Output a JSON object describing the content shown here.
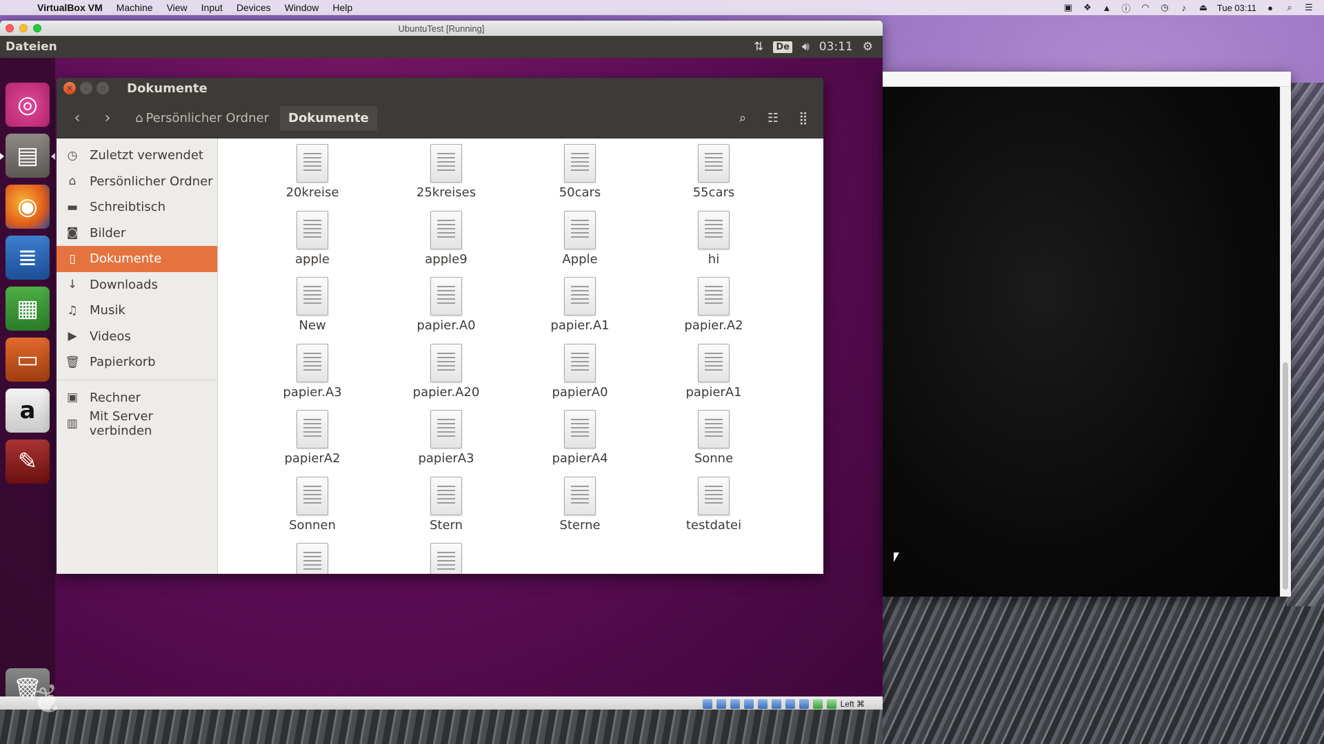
{
  "mac_menubar": {
    "app": "VirtualBox VM",
    "menus": [
      "Machine",
      "View",
      "Input",
      "Devices",
      "Window",
      "Help"
    ],
    "clock": "Tue 03:11"
  },
  "vbox": {
    "title": "UbuntuTest [Running]",
    "status_host_key": "Left ⌘"
  },
  "ubuntu_panel": {
    "app_name": "Dateien",
    "lang": "De",
    "time": "03:11"
  },
  "nautilus": {
    "title": "Dokumente",
    "breadcrumb": {
      "home": "Persönlicher Ordner",
      "current": "Dokumente"
    },
    "sidebar": {
      "items": [
        {
          "label": "Zuletzt verwendet",
          "icon": "clock-icon"
        },
        {
          "label": "Persönlicher Ordner",
          "icon": "home-icon"
        },
        {
          "label": "Schreibtisch",
          "icon": "desktop-folder-icon"
        },
        {
          "label": "Bilder",
          "icon": "camera-icon"
        },
        {
          "label": "Dokumente",
          "icon": "document-icon",
          "active": true
        },
        {
          "label": "Downloads",
          "icon": "download-icon"
        },
        {
          "label": "Musik",
          "icon": "music-icon"
        },
        {
          "label": "Videos",
          "icon": "video-icon"
        },
        {
          "label": "Papierkorb",
          "icon": "trash-icon"
        }
      ],
      "network": [
        {
          "label": "Rechner",
          "icon": "computer-icon"
        },
        {
          "label": "Mit Server verbinden",
          "icon": "server-icon"
        }
      ]
    },
    "files": [
      "20kreise",
      "25kreises",
      "50cars",
      "55cars",
      "apple",
      "apple9",
      "Apple",
      "hi",
      "New",
      "papier.A0",
      "papier.A1",
      "papier.A2",
      "papier.A3",
      "papier.A20",
      "papierA0",
      "papierA1",
      "papierA2",
      "papierA3",
      "papierA4",
      "Sonne",
      "Sonnen",
      "Stern",
      "Sterne",
      "testdatei",
      "",
      ""
    ]
  }
}
